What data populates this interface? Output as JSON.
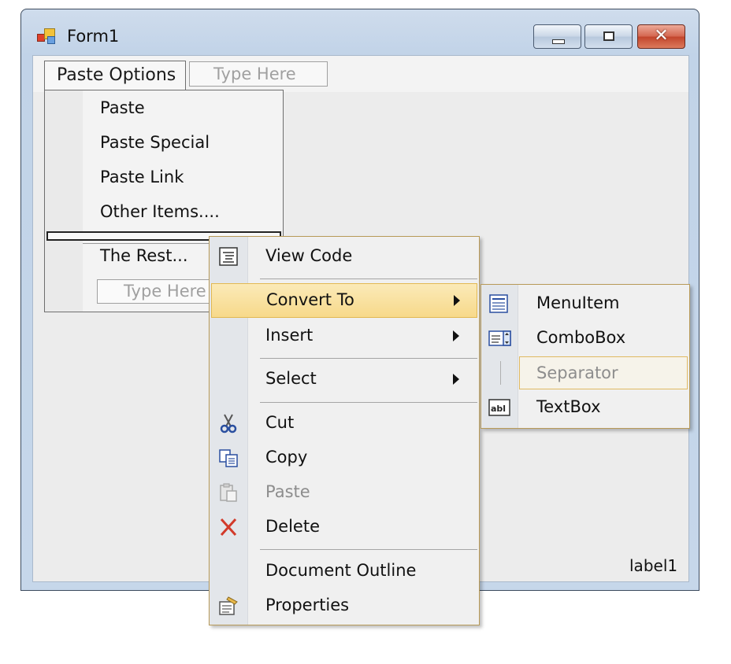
{
  "window": {
    "title": "Form1",
    "close_glyph": "✕",
    "icon": "form-app-icon"
  },
  "menustrip": {
    "paste_options": "Paste Options",
    "type_here": "Type Here"
  },
  "dropdown": {
    "items": [
      "Paste",
      "Paste Special",
      "Paste Link",
      "Other Items....",
      "The Rest..."
    ],
    "type_here": "Type Here"
  },
  "form": {
    "label": "label1"
  },
  "context_menu": {
    "view_code": "View Code",
    "convert_to": "Convert To",
    "insert": "Insert",
    "select": "Select",
    "cut": "Cut",
    "copy": "Copy",
    "paste": "Paste",
    "delete": "Delete",
    "document_outline": "Document Outline",
    "properties": "Properties"
  },
  "submenu": {
    "menu_item": "MenuItem",
    "combo_box": "ComboBox",
    "separator": "Separator",
    "text_box": "TextBox",
    "textbox_icon_text": "abl"
  },
  "colors": {
    "highlight": "#f7d98a",
    "menu_border": "#b89a58",
    "delete_red": "#d23a2a",
    "cut_blue": "#2a4fa0"
  }
}
